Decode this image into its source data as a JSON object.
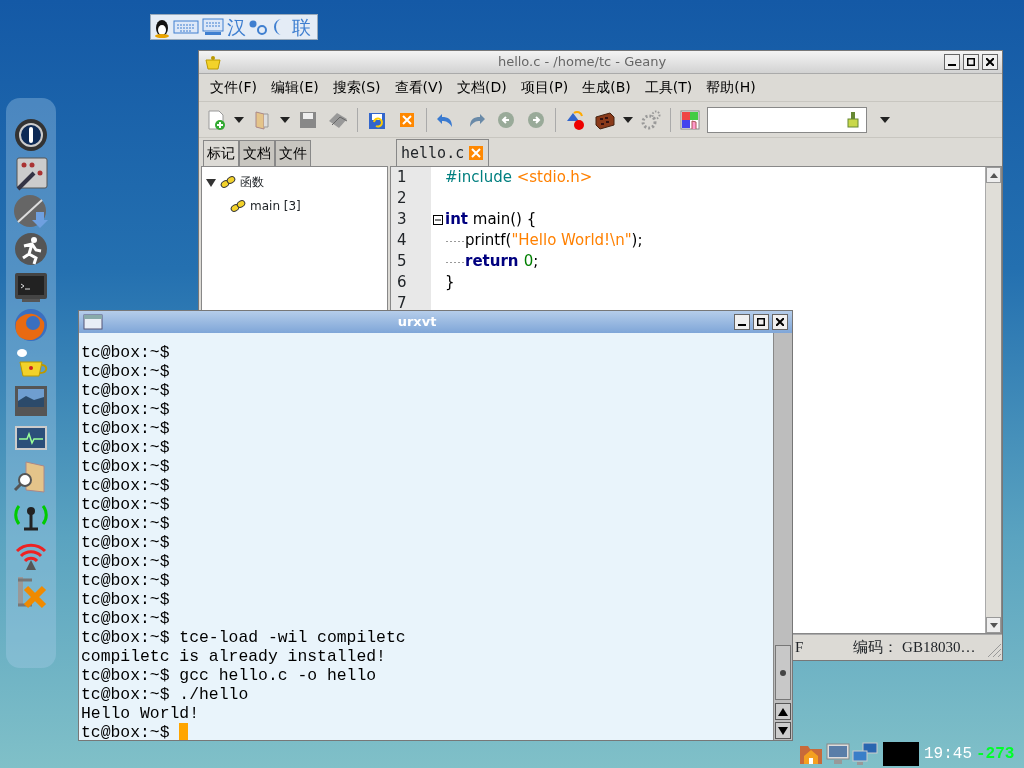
{
  "ime_bar": {
    "items": [
      "汉",
      "联"
    ]
  },
  "geany": {
    "title": "hello.c - /home/tc - Geany",
    "menu": [
      "文件(F)",
      "编辑(E)",
      "搜索(S)",
      "查看(V)",
      "文档(D)",
      "项目(P)",
      "生成(B)",
      "工具(T)",
      "帮助(H)"
    ],
    "sidebar_tabs": [
      {
        "label": "标记",
        "selected": true
      },
      {
        "label": "文档",
        "selected": false
      },
      {
        "label": "文件",
        "selected": false
      }
    ],
    "symbols": [
      {
        "label": "函数",
        "expanded": true,
        "children": [
          {
            "label": "main [3]"
          }
        ]
      }
    ],
    "editor_tab": "hello.c",
    "lines": [
      {
        "number": "1",
        "tokens": [
          {
            "kind": "preprocessor",
            "text": "#include "
          },
          {
            "kind": "string",
            "text": "<stdio.h>"
          }
        ]
      },
      {
        "number": "2"
      },
      {
        "number": "3",
        "fold": true,
        "tokens": [
          {
            "kind": "keyword",
            "text": "int"
          },
          {
            "kind": "plain",
            "text": " main() {"
          }
        ]
      },
      {
        "number": "4",
        "indented": true,
        "tokens": [
          {
            "kind": "plain",
            "text": "printf("
          },
          {
            "kind": "string",
            "text": "\"Hello World!\\n\""
          },
          {
            "kind": "plain",
            "text": ");"
          }
        ]
      },
      {
        "number": "5",
        "indented": true,
        "tokens": [
          {
            "kind": "keyword",
            "text": "return "
          },
          {
            "kind": "number",
            "text": "0"
          },
          {
            "kind": "plain",
            "text": ";"
          }
        ]
      },
      {
        "number": "6",
        "tokens": [
          {
            "kind": "plain",
            "text": "}"
          }
        ]
      },
      {
        "number": "7"
      }
    ],
    "status_bar": [
      "F",
      "编码： GB18030…"
    ]
  },
  "terminal": {
    "title": "urxvt",
    "cursor": true,
    "lines": [
      "tc@box:~$",
      "tc@box:~$",
      "tc@box:~$",
      "tc@box:~$",
      "tc@box:~$",
      "tc@box:~$",
      "tc@box:~$",
      "tc@box:~$",
      "tc@box:~$",
      "tc@box:~$",
      "tc@box:~$",
      "tc@box:~$",
      "tc@box:~$",
      "tc@box:~$",
      "tc@box:~$",
      "tc@box:~$ tce-load -wil compiletc",
      "compiletc is already installed!",
      "tc@box:~$ gcc hello.c -o hello",
      "tc@box:~$ ./hello",
      "Hello World!",
      "tc@box:~$ "
    ]
  },
  "tray": {
    "clock": "19:45",
    "temperature": "-273"
  }
}
